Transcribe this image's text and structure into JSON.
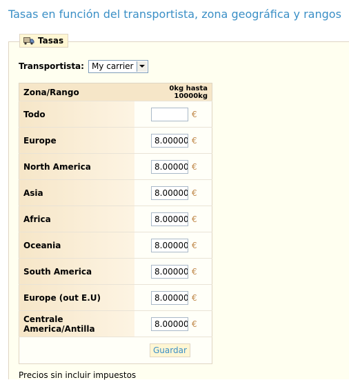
{
  "page_title": "Tasas en función del transportista, zona geográfica y rangos",
  "section": {
    "legend": "Tasas",
    "icon": "truck-icon"
  },
  "carrier": {
    "label": "Transportista:",
    "selected": "My carrier"
  },
  "table": {
    "zone_header": "Zona/Rango",
    "range_header": "0kg hasta 10000kg",
    "currency": "€",
    "rows": [
      {
        "zone": "Todo",
        "value": ""
      },
      {
        "zone": "Europe",
        "value": "8.00000"
      },
      {
        "zone": "North America",
        "value": "8.00000"
      },
      {
        "zone": "Asia",
        "value": "8.00000"
      },
      {
        "zone": "Africa",
        "value": "8.00000"
      },
      {
        "zone": "Oceania",
        "value": "8.00000"
      },
      {
        "zone": "South America",
        "value": "8.00000"
      },
      {
        "zone": "Europe (out E.U)",
        "value": "8.00000"
      },
      {
        "zone": "Centrale America/Antilla",
        "value": "8.00000"
      }
    ],
    "save_label": "Guardar"
  },
  "footnote": "Precios sin incluir impuestos",
  "colors": {
    "title": "#3a8fc6",
    "header_bg": "#f6e6c8",
    "panel_bg": "#fffff0",
    "euro": "#c0894a"
  }
}
